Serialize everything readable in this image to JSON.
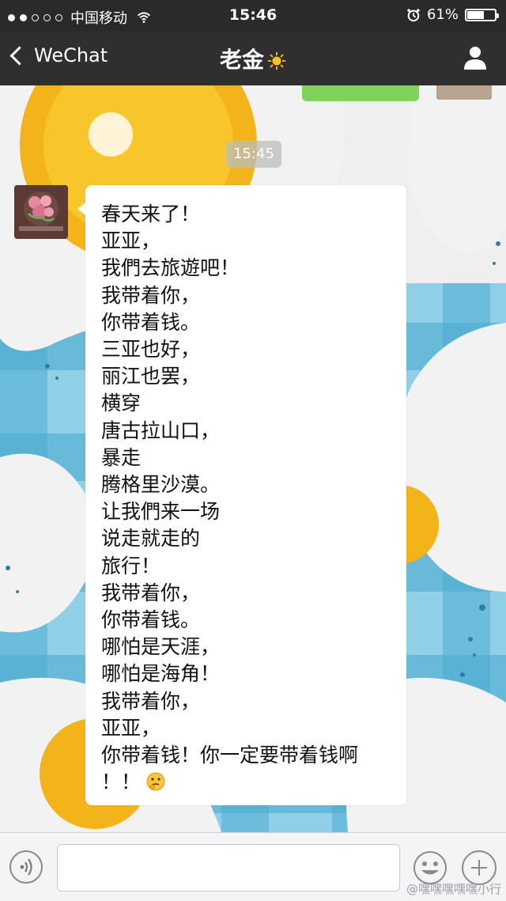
{
  "status_bar": {
    "signal_dots": [
      true,
      true,
      false,
      false,
      false
    ],
    "carrier": "中国移动",
    "wifi_icon": "wifi-icon",
    "time": "15:46",
    "alarm_icon": "alarm-icon",
    "battery_percent_label": "61%",
    "battery_level": 0.61
  },
  "nav": {
    "back_label": "WeChat",
    "title": "老金",
    "title_icon": "sun-icon",
    "profile_icon": "person-icon"
  },
  "chat": {
    "timestamp": "15:45",
    "message_lines": [
      "春天来了！",
      "亚亚，",
      "我們去旅遊吧！",
      "我带着你，",
      "你带着钱。",
      "三亚也好，",
      "丽江也罢，",
      "横穿",
      "唐古拉山口，",
      "暴走",
      "腾格里沙漠。",
      "让我們来一场",
      "说走就走的",
      "旅行！",
      "我带着你，",
      "你带着钱。",
      "哪怕是天涯，",
      "哪怕是海角！",
      "我带着你，",
      "亚亚，",
      "你带着钱！你一定要带着钱啊",
      "！！"
    ],
    "message_end_emoji": "thinking-face-icon"
  },
  "input_bar": {
    "voice_icon": "voice-icon",
    "emoji_icon": "smiley-icon",
    "plus_icon": "plus-icon",
    "watermark": "@嘿嘿嘿嘿嘿小行"
  },
  "colors": {
    "nav_background": "#2f2f2f",
    "chat_wallpaper_blue": "#8fd0e6",
    "egg_yolk": "#f3b41b",
    "sent_bubble": "#7fd35a"
  }
}
